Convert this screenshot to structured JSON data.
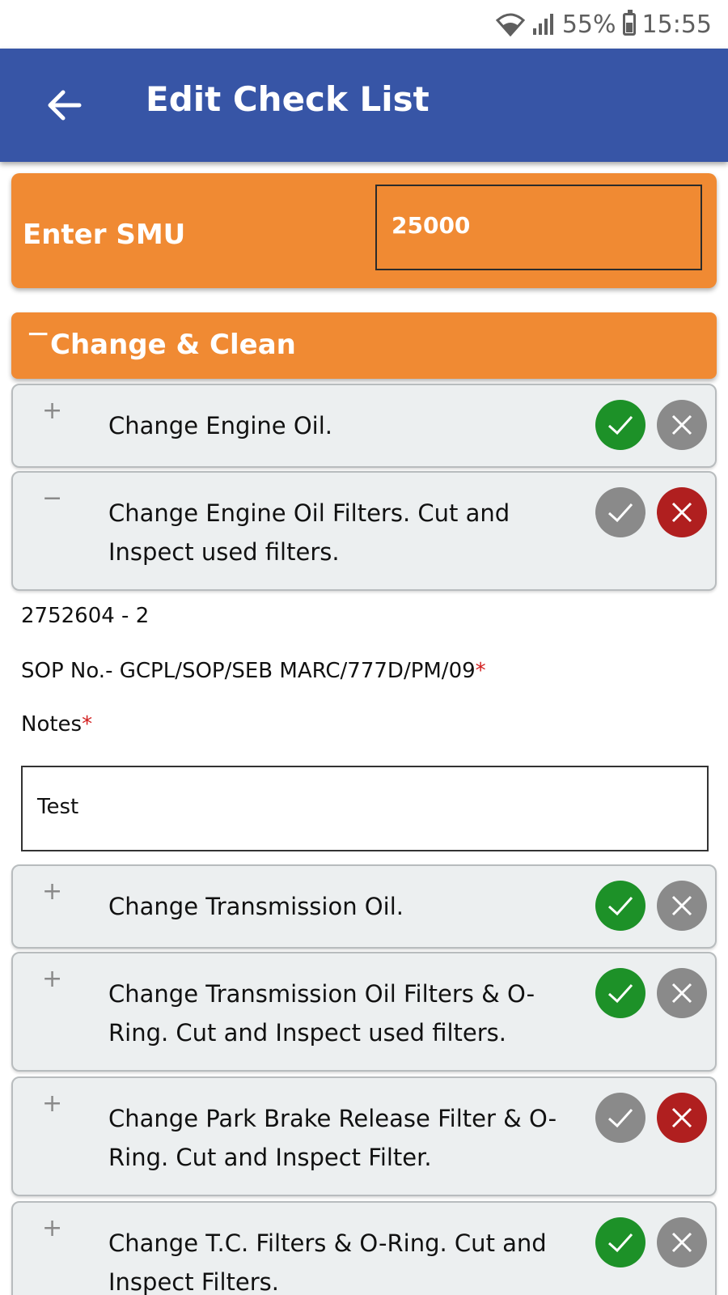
{
  "status_bar": {
    "battery": "55%",
    "time": "15:55"
  },
  "app_bar": {
    "title": "Edit Check List"
  },
  "smu": {
    "label": "Enter SMU",
    "value": "25000"
  },
  "section": {
    "toggle": "−",
    "title": "Change & Clean"
  },
  "items": [
    {
      "toggle": "+",
      "text": "Change Engine Oil.",
      "ok_state": "active",
      "no_state": "inactive"
    },
    {
      "toggle": "−",
      "text": "Change Engine Oil Filters. Cut and Inspect used filters.",
      "ok_state": "inactive",
      "no_state": "active"
    },
    {
      "toggle": "+",
      "text": "Change Transmission Oil.",
      "ok_state": "active",
      "no_state": "inactive"
    },
    {
      "toggle": "+",
      "text": "Change Transmission Oil Filters & O-Ring. Cut and Inspect used filters.",
      "ok_state": "active",
      "no_state": "inactive"
    },
    {
      "toggle": "+",
      "text": "Change Park Brake Release Filter & O-Ring. Cut and Inspect Filter.",
      "ok_state": "inactive",
      "no_state": "active"
    },
    {
      "toggle": "+",
      "text": "Change T.C. Filters & O-Ring. Cut and Inspect Filters.",
      "ok_state": "active",
      "no_state": "inactive"
    }
  ],
  "details": {
    "part_no": "2752604 - 2",
    "sop": "SOP No.- GCPL/SOP/SEB MARC/777D/PM/09",
    "required_mark": "*",
    "notes_label": "Notes",
    "notes_value": "Test"
  },
  "colors": {
    "app_bar": "#3755a6",
    "accent_orange": "#f08a33",
    "approve_green": "#1d9128",
    "reject_red": "#b01f1f",
    "inactive_grey": "#8a8a8a"
  }
}
